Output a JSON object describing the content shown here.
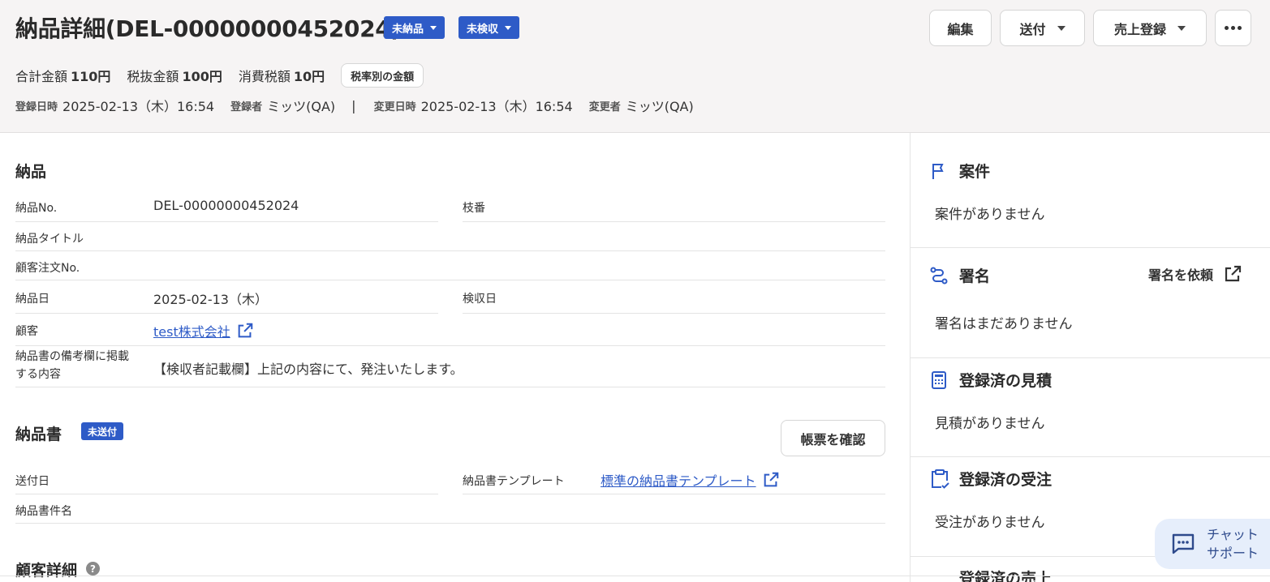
{
  "header": {
    "title": "納品詳細(DEL-00000000452024)",
    "badge_delivery": "未納品",
    "badge_inspection": "未検収",
    "edit_button": "編集",
    "send_button": "送付",
    "sales_button": "売上登録",
    "amounts": {
      "total_label": "合計金額",
      "total_value": "110円",
      "pretax_label": "税抜金額",
      "pretax_value": "100円",
      "tax_label": "消費税額",
      "tax_value": "10円",
      "by_rate_chip": "税率別の金額"
    },
    "meta": {
      "created_label": "登録日時",
      "created_value": "2025-02-13（木）16:54",
      "creator_label": "登録者",
      "creator_value": "ミッツ(QA)",
      "separator": "|",
      "updated_label": "変更日時",
      "updated_value": "2025-02-13（木）16:54",
      "updater_label": "変更者",
      "updater_value": "ミッツ(QA)"
    }
  },
  "delivery": {
    "section_title": "納品",
    "no_label": "納品No.",
    "no_value": "DEL-00000000452024",
    "branch_label": "枝番",
    "branch_value": "",
    "title_label": "納品タイトル",
    "title_value": "",
    "order_no_label": "顧客注文No.",
    "order_no_value": "",
    "date_label": "納品日",
    "date_value": "2025-02-13（木）",
    "inspection_label": "検収日",
    "inspection_value": "",
    "customer_label": "顧客",
    "customer_value": "test株式会社",
    "remarks_label_1": "納品書の備考欄に掲載",
    "remarks_label_2": "する内容",
    "remarks_value": "【検収者記載欄】上記の内容にて、発注いたします。"
  },
  "document": {
    "section_title": "納品書",
    "status_chip": "未送付",
    "confirm_button": "帳票を確認",
    "sent_date_label": "送付日",
    "sent_date_value": "",
    "template_label": "納品書テンプレート",
    "template_value": "標準の納品書テンプレート",
    "doc_name_label": "納品書件名",
    "doc_name_value": ""
  },
  "customer_detail": {
    "section_title": "顧客詳細",
    "help": "?"
  },
  "sidebar": {
    "project_title": "案件",
    "project_empty": "案件がありません",
    "signature_title": "署名",
    "signature_request": "署名を依頼",
    "signature_empty": "署名はまだありません",
    "estimates_title": "登録済の見積",
    "estimates_empty": "見積がありません",
    "orders_title": "登録済の受注",
    "orders_empty": "受注がありません",
    "sales_title": "登録済の売上"
  },
  "chat": {
    "line1": "チャット",
    "line2": "サポート"
  },
  "colors": {
    "accent": "#2e5bc7",
    "header_bg": "#f6f4f4",
    "chat_bg": "#e6eefb"
  }
}
